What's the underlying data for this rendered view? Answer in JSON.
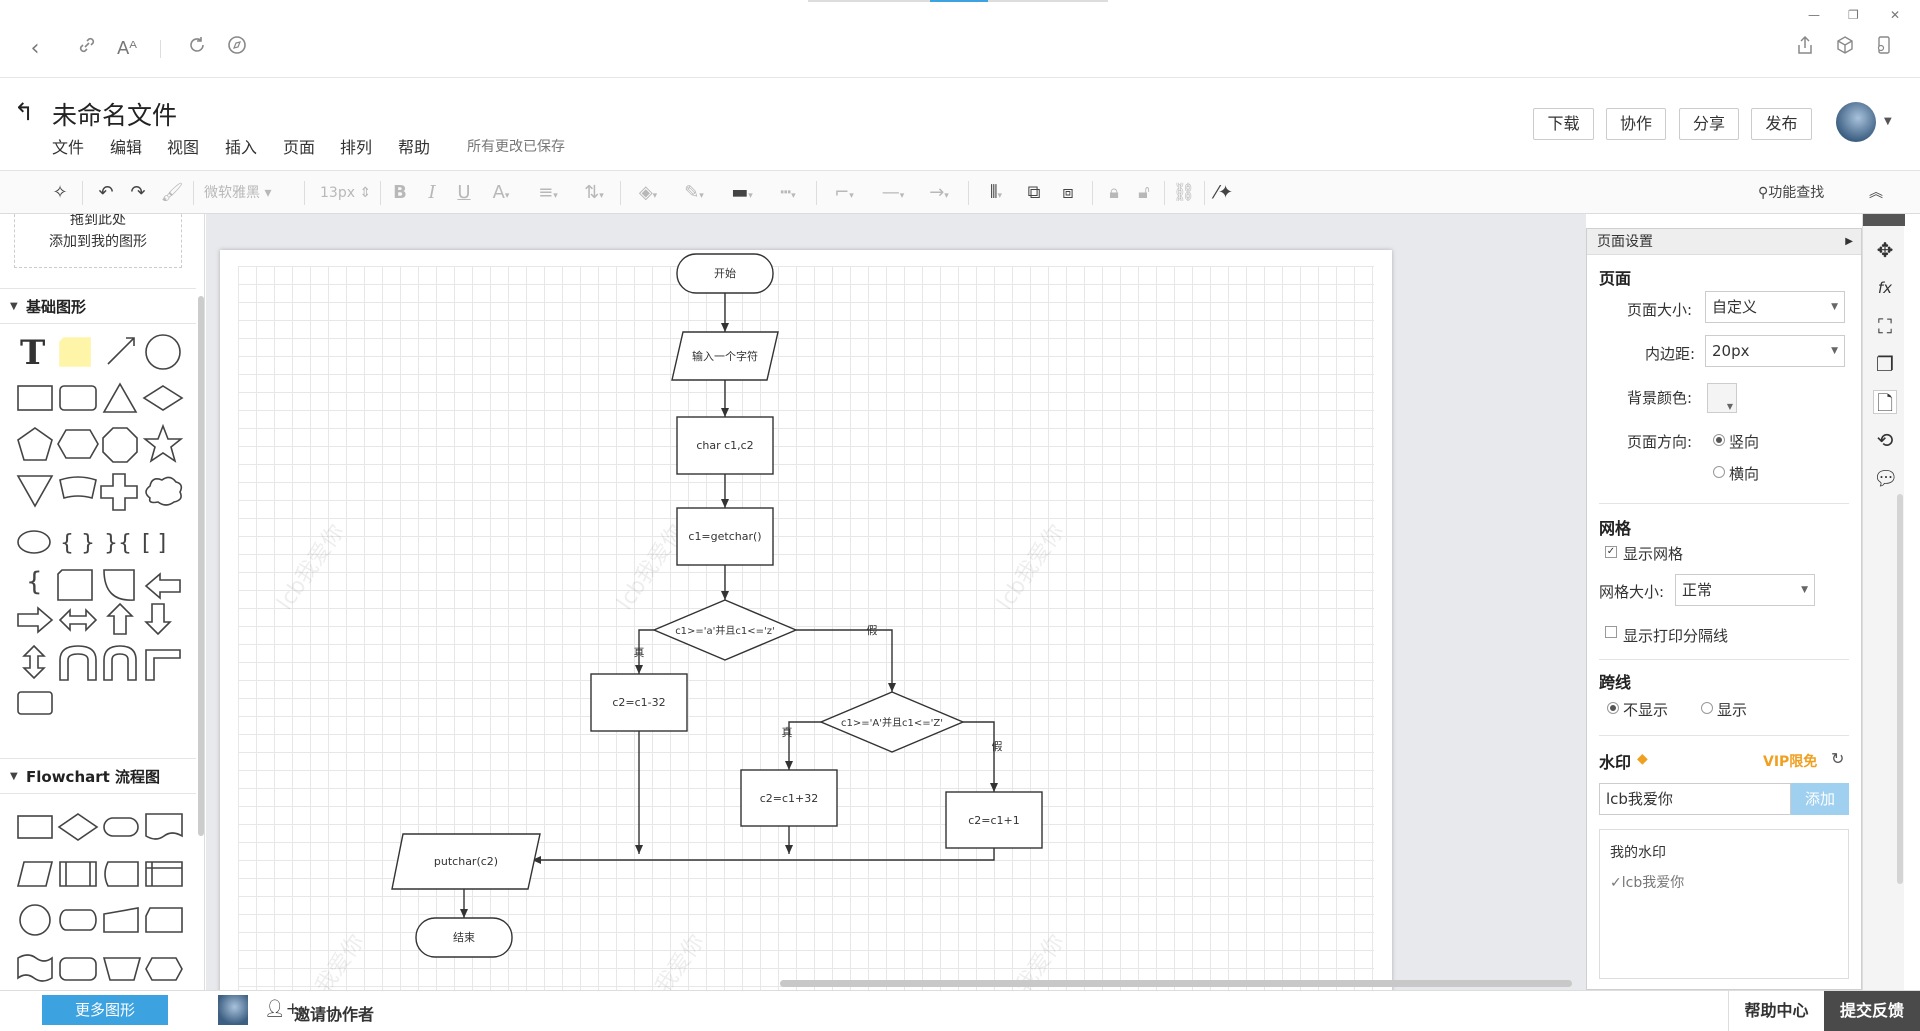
{
  "browser": {
    "icons": [
      "back-icon",
      "link-icon",
      "font-size-icon",
      "refresh-icon",
      "compass-icon",
      "share-icon",
      "box-icon",
      "phone-icon"
    ],
    "window_controls": [
      "—",
      "❐",
      "✕"
    ]
  },
  "header": {
    "title": "未命名文件",
    "menu": [
      "文件",
      "编辑",
      "视图",
      "插入",
      "页面",
      "排列",
      "帮助"
    ],
    "save_status": "所有更改已保存",
    "buttons": {
      "download": "下载",
      "collaborate": "协作",
      "share": "分享",
      "publish": "发布"
    }
  },
  "toolbar": {
    "font_family": "微软雅黑",
    "font_size": "13px",
    "search_label": "功能查找"
  },
  "left_panel": {
    "drop_hint_line1": "拖到此处",
    "drop_hint_line2": "添加到我的图形",
    "section_basic": "基础图形",
    "section_flowchart": "Flowchart 流程图",
    "more_shapes": "更多图形"
  },
  "diagram": {
    "watermark_text": "lcb我爱你",
    "nodes": {
      "start": "开始",
      "input": "输入一个字符",
      "declare": "char c1,c2",
      "getchar": "c1=getchar()",
      "cond1": "c1>='a'并且c1<='z'",
      "minus": "c2=c1-32",
      "cond2": "c1>='A'并且c1<='Z'",
      "plus32": "c2=c1+32",
      "plus1": "c2=c1+1",
      "putchar": "putchar(c2)",
      "end": "结束"
    },
    "edge_labels": {
      "true1": "真",
      "false1": "假",
      "true2": "真",
      "false2": "假"
    }
  },
  "settings": {
    "panel_title": "页面设置",
    "page_heading": "页面",
    "page_size_label": "页面大小:",
    "page_size_value": "自定义",
    "padding_label": "内边距:",
    "padding_value": "20px",
    "bg_color_label": "背景颜色:",
    "orientation_label": "页面方向:",
    "orientation_portrait": "竖向",
    "orientation_landscape": "横向",
    "grid_heading": "网格",
    "show_grid_label": "显示网格",
    "grid_size_label": "网格大小:",
    "grid_size_value": "正常",
    "show_print_label": "显示打印分隔线",
    "cross_heading": "跨线",
    "cross_hide": "不显示",
    "cross_show": "显示",
    "watermark_heading": "水印",
    "vip_label": "VIP限免",
    "watermark_input_value": "lcb我爱你",
    "add_button": "添加",
    "my_watermark_label": "我的水印",
    "my_watermark_item": "lcb我爱你"
  },
  "bottom": {
    "invite": "邀请协作者",
    "help_center": "帮助中心",
    "feedback": "提交反馈"
  },
  "colors": {
    "accent": "#3ca2e0",
    "vip": "#f0a020",
    "feedback_bg": "#4a4a4a"
  }
}
